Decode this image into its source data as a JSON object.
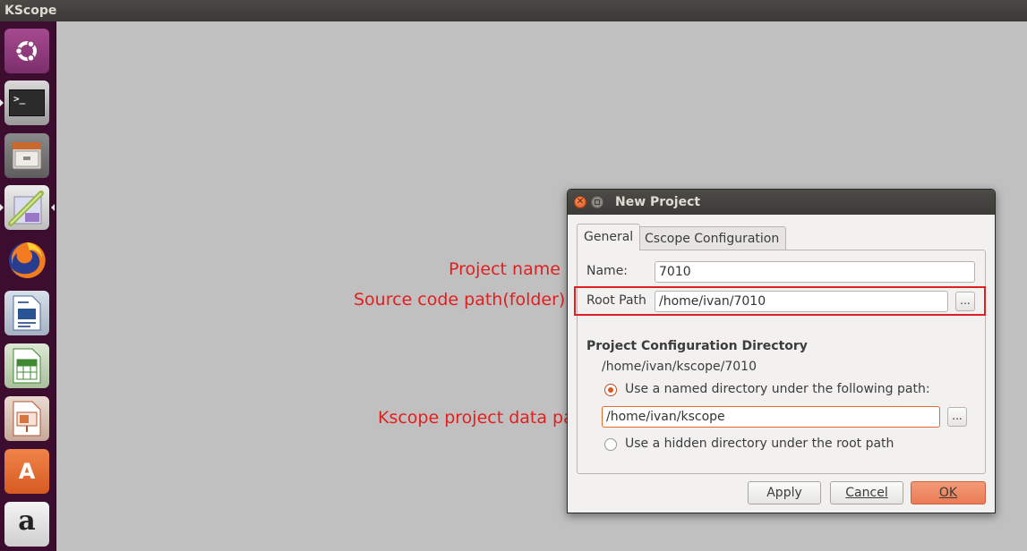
{
  "app": {
    "title": "KScope"
  },
  "launcher": {
    "items": [
      {
        "name": "ubuntu-dash-icon"
      },
      {
        "name": "terminal-icon",
        "glyph": ">_"
      },
      {
        "name": "files-icon"
      },
      {
        "name": "kscope-icon"
      },
      {
        "name": "firefox-icon"
      },
      {
        "name": "libreoffice-writer-icon"
      },
      {
        "name": "libreoffice-calc-icon"
      },
      {
        "name": "libreoffice-impress-icon"
      },
      {
        "name": "software-center-icon",
        "glyph": "A"
      },
      {
        "name": "amazon-icon",
        "glyph": "a"
      }
    ]
  },
  "annotations": {
    "project_name": "Project name",
    "source_path": "Source code path(folder)",
    "data_path": "Kscope project data path"
  },
  "dialog": {
    "title": "New Project",
    "tabs": [
      {
        "label": "General",
        "active": true
      },
      {
        "label": "Cscope Configuration",
        "active": false
      }
    ],
    "name_label": "Name:",
    "name_value": "7010",
    "root_label": "Root Path",
    "root_value": "/home/ivan/7010",
    "browse_label": "...",
    "config_heading": "Project Configuration Directory",
    "config_path": "/home/ivan/kscope/7010",
    "radio_named_label": "Use a named directory under the following path:",
    "radio_named_selected": true,
    "named_path_value": "/home/ivan/kscope",
    "radio_hidden_label": "Use a hidden directory under the root path",
    "radio_hidden_selected": false,
    "buttons": {
      "apply": "Apply",
      "cancel": "Cancel",
      "ok": "OK"
    }
  },
  "colors": {
    "launcher_bg": "#3c0d2e",
    "desktop_bg": "#c0c0c0",
    "accent": "#e0692f",
    "annotation": "#e02020"
  }
}
